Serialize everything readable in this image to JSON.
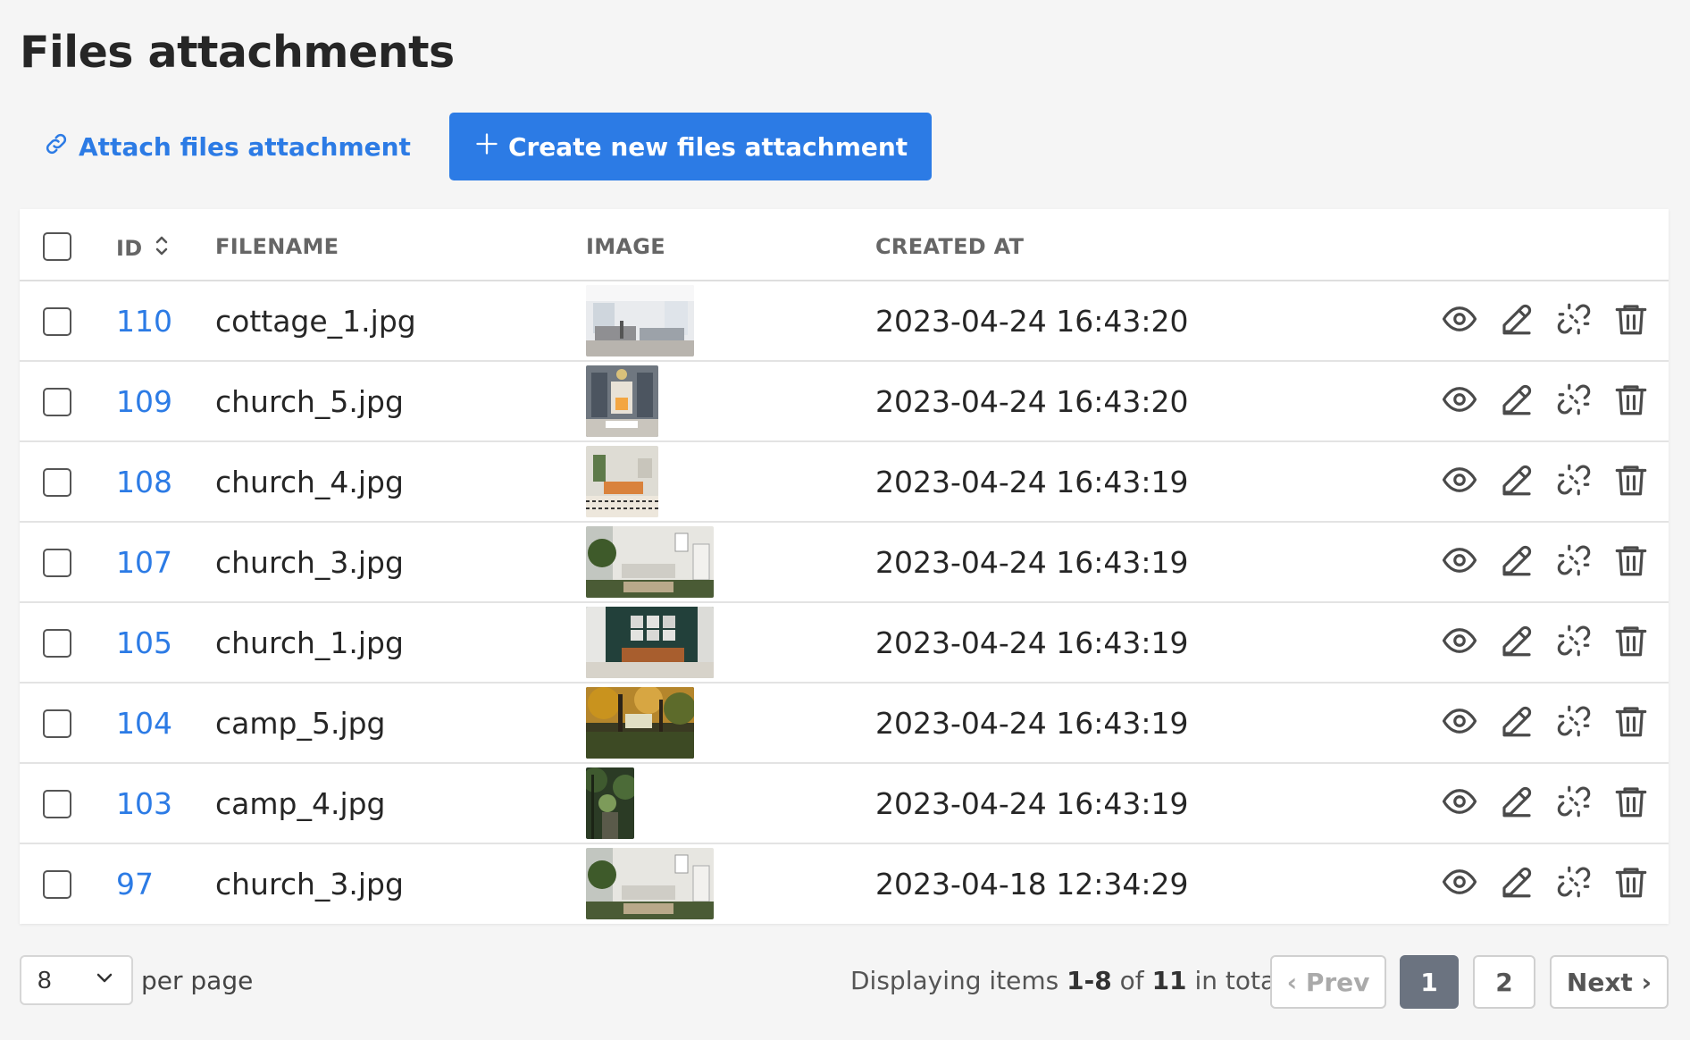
{
  "page": {
    "title": "Files attachments"
  },
  "toolbar": {
    "attach_label": "Attach files attachment",
    "create_label": "Create new files attachment"
  },
  "table": {
    "headers": {
      "id": "ID",
      "filename": "FILENAME",
      "image": "IMAGE",
      "created_at": "CREATED AT"
    },
    "rows": [
      {
        "id": "110",
        "filename": "cottage_1.jpg",
        "created_at": "2023-04-24 16:43:20",
        "thumb": "cottage"
      },
      {
        "id": "109",
        "filename": "church_5.jpg",
        "created_at": "2023-04-24 16:43:20",
        "thumb": "fireplace"
      },
      {
        "id": "108",
        "filename": "church_4.jpg",
        "created_at": "2023-04-24 16:43:19",
        "thumb": "orange-sofa"
      },
      {
        "id": "107",
        "filename": "church_3.jpg",
        "created_at": "2023-04-24 16:43:19",
        "thumb": "plant-room"
      },
      {
        "id": "105",
        "filename": "church_1.jpg",
        "created_at": "2023-04-24 16:43:19",
        "thumb": "green-wall"
      },
      {
        "id": "104",
        "filename": "camp_5.jpg",
        "created_at": "2023-04-24 16:43:19",
        "thumb": "autumn-forest"
      },
      {
        "id": "103",
        "filename": "camp_4.jpg",
        "created_at": "2023-04-24 16:43:19",
        "thumb": "forest-path"
      },
      {
        "id": "97",
        "filename": "church_3.jpg",
        "created_at": "2023-04-18 12:34:29",
        "thumb": "plant-room"
      }
    ]
  },
  "pagination": {
    "per_page_value": "8",
    "per_page_label": "per page",
    "display_prefix": "Displaying items",
    "display_range": "1-8",
    "display_of": "of",
    "display_total": "11",
    "display_suffix": "in total",
    "prev_label": "‹ Prev",
    "page_1": "1",
    "page_2": "2",
    "next_label": "Next ›"
  },
  "colors": {
    "accent": "#2c7be5",
    "active_page": "#6b7380"
  },
  "icons": [
    "link-icon",
    "plus-icon",
    "sort-icon",
    "eye-icon",
    "pencil-icon",
    "unlink-icon",
    "trash-icon",
    "chevron-down-icon"
  ]
}
